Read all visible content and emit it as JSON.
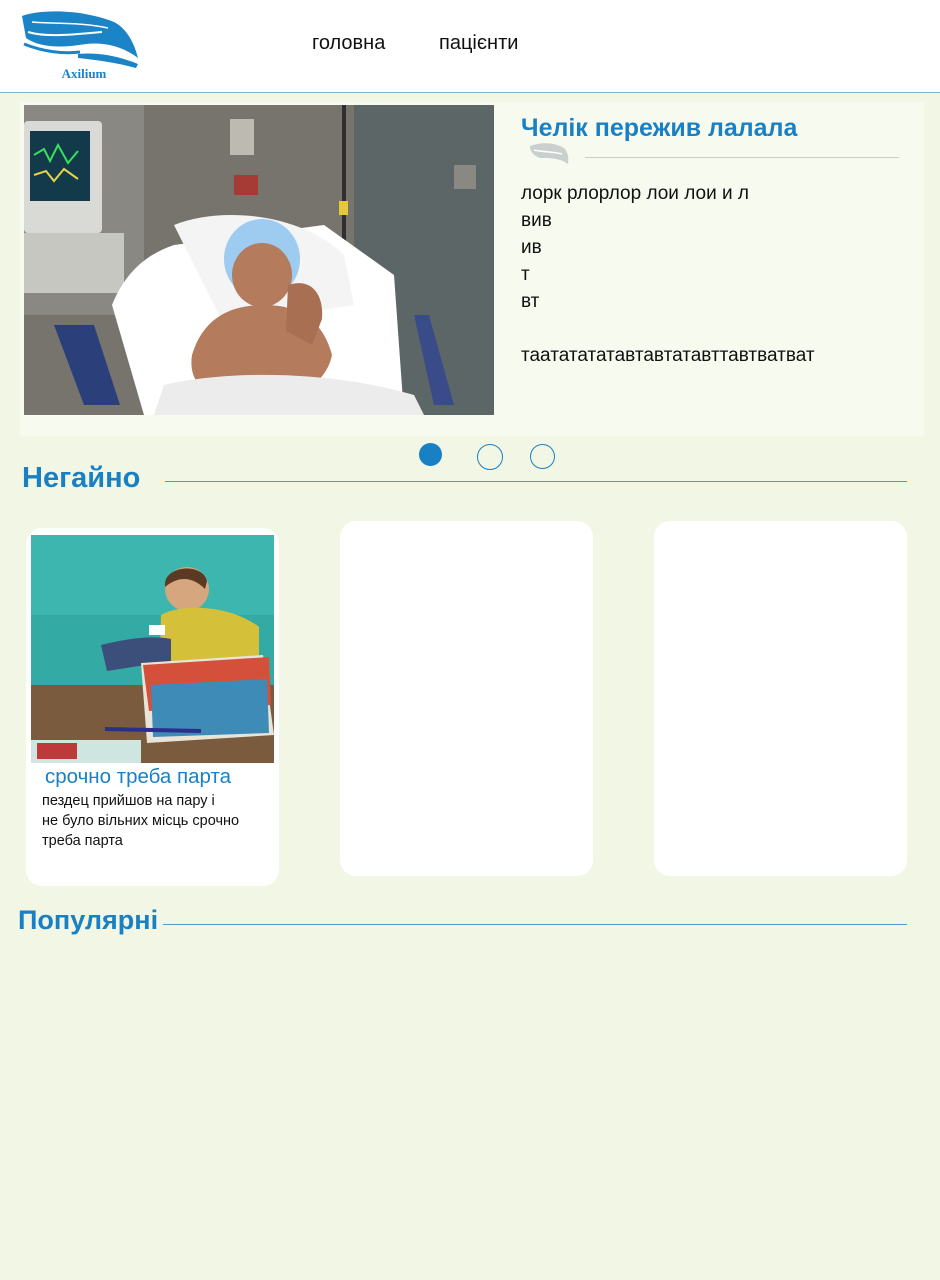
{
  "header": {
    "logo_text": "Axilium",
    "nav": [
      {
        "label": "головна"
      },
      {
        "label": "пацієнти"
      }
    ]
  },
  "hero": {
    "title": "Челік пережив лалала",
    "body_lines": [
      "лорк рлорлор лои лои и л",
      "вив",
      "ив",
      "т",
      "вт",
      "",
      "таататататавтавтатавттавтватват"
    ],
    "image": "patient-in-hospital-bed-photo"
  },
  "carousel": {
    "dots": 3,
    "active_index": 0
  },
  "sections": {
    "urgent_title": "Негайно",
    "popular_title": "Популярні"
  },
  "cards": [
    {
      "title": "срочно треба парта",
      "text_lines": [
        "пездец прийшов на пару і",
        "не було вільних місць срочно",
        "треба парта"
      ],
      "image": "student-writing-at-desk-photo"
    },
    {
      "title": "",
      "text_lines": []
    },
    {
      "title": "",
      "text_lines": []
    }
  ],
  "colors": {
    "accent": "#1a80c4",
    "page_background": "#f2f6e5",
    "header_background": "#ffffff"
  }
}
